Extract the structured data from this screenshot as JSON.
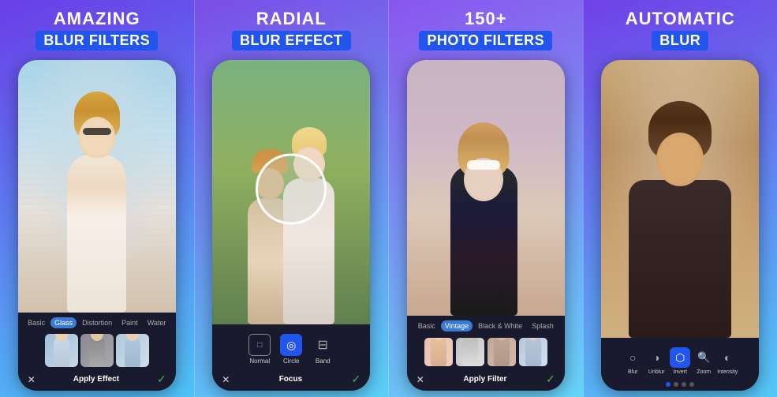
{
  "panels": [
    {
      "id": "panel-1",
      "title_top": "AMAZING",
      "title_bottom": "BLUR FILTERS",
      "filter_tabs": [
        {
          "label": "Basic",
          "active": false
        },
        {
          "label": "Glass",
          "active": true
        },
        {
          "label": "Distortion",
          "active": false
        },
        {
          "label": "Paint",
          "active": false
        },
        {
          "label": "Water",
          "active": false
        }
      ],
      "bottom_label": "Apply Effect",
      "thumbnails": [
        {
          "bg": "thumb-1"
        },
        {
          "bg": "thumb-2"
        },
        {
          "bg": "thumb-3"
        }
      ]
    },
    {
      "id": "panel-2",
      "title_top": "RADIAL",
      "title_bottom": "BLUR EFFECT",
      "focus_options": [
        {
          "label": "Normal",
          "icon": "□",
          "active": false
        },
        {
          "label": "Circle",
          "icon": "◎",
          "active": true
        },
        {
          "label": "Band",
          "icon": "⊟",
          "active": false
        }
      ],
      "bottom_label": "Focus"
    },
    {
      "id": "panel-3",
      "title_top": "150+",
      "title_bottom": "PHOTO FILTERS",
      "filter_tabs": [
        {
          "label": "Basic",
          "active": false
        },
        {
          "label": "Vintage",
          "active": true
        },
        {
          "label": "Black & White",
          "active": false
        },
        {
          "label": "Splash",
          "active": false
        }
      ],
      "bottom_label": "Apply Filter",
      "thumbnails": [
        {
          "bg": "ft-1"
        },
        {
          "bg": "ft-2"
        },
        {
          "bg": "ft-3"
        },
        {
          "bg": "ft-4"
        }
      ]
    },
    {
      "id": "panel-4",
      "title_top": "AUTOMATIC",
      "title_bottom": "BLUR",
      "tools": [
        {
          "label": "Blur",
          "active": false
        },
        {
          "label": "Unblur",
          "active": false
        },
        {
          "label": "Invert",
          "active": true
        },
        {
          "label": "Zoom",
          "active": false
        },
        {
          "label": "Intensity",
          "active": false
        }
      ]
    }
  ]
}
